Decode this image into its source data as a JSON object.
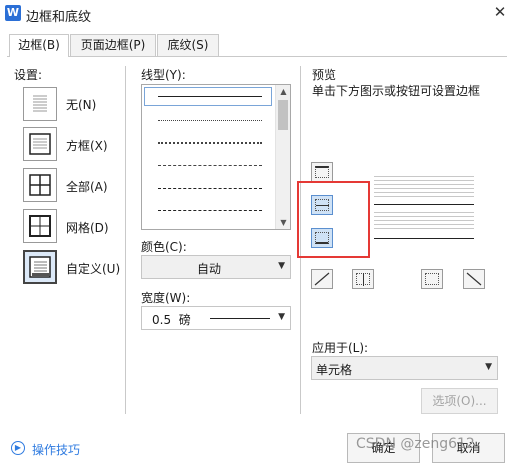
{
  "window": {
    "title": "边框和底纹",
    "app_icon": "W",
    "close_glyph": "✕"
  },
  "tabs": [
    {
      "label": "边框(B)",
      "active": true
    },
    {
      "label": "页面边框(P)",
      "active": false
    },
    {
      "label": "底纹(S)",
      "active": false
    }
  ],
  "settings": {
    "label": "设置:",
    "items": [
      {
        "label": "无(N)",
        "icon": "setting-none-icon"
      },
      {
        "label": "方框(X)",
        "icon": "setting-box-icon"
      },
      {
        "label": "全部(A)",
        "icon": "setting-all-icon"
      },
      {
        "label": "网格(D)",
        "icon": "setting-grid-icon"
      },
      {
        "label": "自定义(U)",
        "icon": "setting-custom-icon",
        "selected": true
      }
    ]
  },
  "style": {
    "label": "线型(Y):",
    "items": [
      "solid",
      "dotted-fine",
      "dotted",
      "dashed-short",
      "dashed",
      "dash-dot",
      "dash-dot-dot"
    ]
  },
  "color": {
    "label": "颜色(C):",
    "value": "自动"
  },
  "width": {
    "label": "宽度(W):",
    "value": "0.5  磅"
  },
  "preview": {
    "label": "预览",
    "hint": "单击下方图示或按钮可设置边框"
  },
  "apply_to": {
    "label": "应用于(L):",
    "value": "单元格"
  },
  "buttons": {
    "options": "选项(O)...",
    "ok": "确定",
    "cancel": "取消"
  },
  "footer": {
    "tips": "操作技巧"
  },
  "watermark": "CSDN @zeng612",
  "colors": {
    "accent": "#2f7be0",
    "highlight": "#e53935",
    "selected_bg": "#cfe2f6"
  }
}
